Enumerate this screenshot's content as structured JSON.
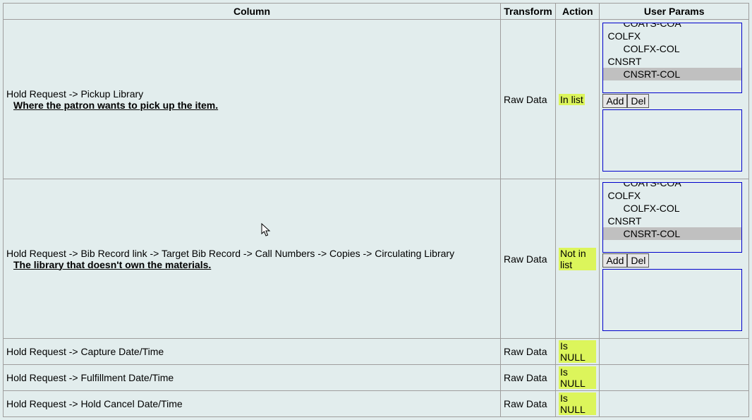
{
  "headers": {
    "column": "Column",
    "transform": "Transform",
    "action": "Action",
    "params": "User Params"
  },
  "rows": [
    {
      "path": "Hold Request -> Pickup Library",
      "desc": "Where the patron wants to pick up the item.",
      "transform": "Raw Data",
      "action": "In list",
      "params": {
        "options": [
          "COATS-COA",
          "COLFX",
          "COLFX-COL",
          "CNSRT",
          "CNSRT-COL"
        ],
        "indent": [
          true,
          false,
          true,
          false,
          true
        ],
        "selected_index": 4,
        "buttons": {
          "add": "Add",
          "del": "Del"
        }
      }
    },
    {
      "path": "Hold Request -> Bib Record link -> Target Bib Record -> Call Numbers -> Copies -> Circulating Library",
      "desc": "The library that doesn't own the materials.",
      "transform": "Raw Data",
      "action": "Not in list",
      "params": {
        "options": [
          "COATS-COA",
          "COLFX",
          "COLFX-COL",
          "CNSRT",
          "CNSRT-COL"
        ],
        "indent": [
          true,
          false,
          true,
          false,
          true
        ],
        "selected_index": 4,
        "buttons": {
          "add": "Add",
          "del": "Del"
        }
      }
    },
    {
      "path": "Hold Request -> Capture Date/Time",
      "transform": "Raw Data",
      "action": "Is NULL"
    },
    {
      "path": "Hold Request -> Fulfillment Date/Time",
      "transform": "Raw Data",
      "action": "Is NULL"
    },
    {
      "path": "Hold Request -> Hold Cancel Date/Time",
      "transform": "Raw Data",
      "action": "Is NULL"
    }
  ]
}
